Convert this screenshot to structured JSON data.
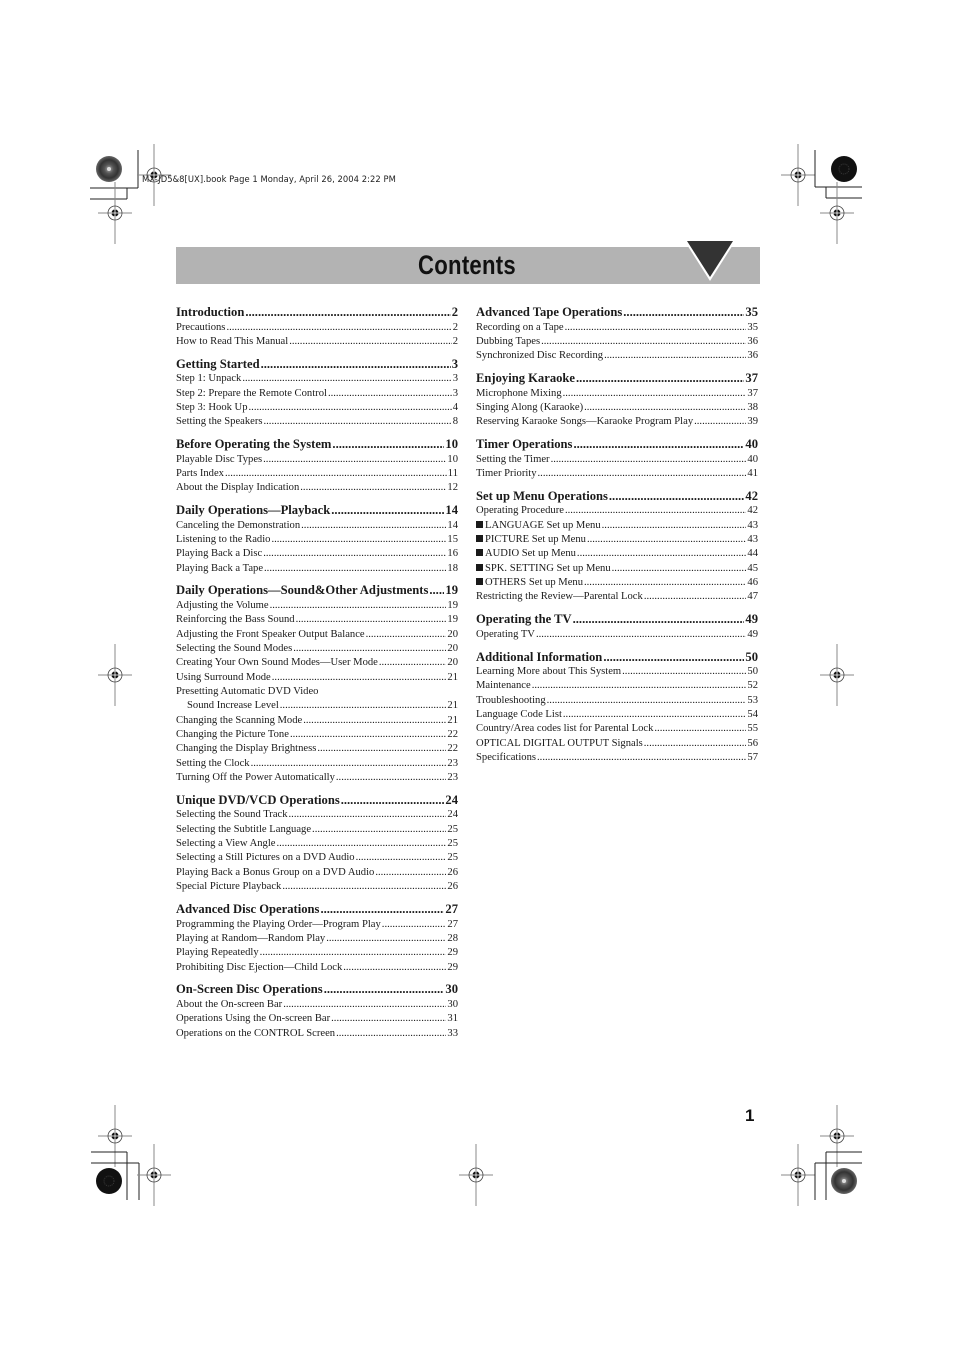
{
  "print_header": "MX-JD5&8[UX].book  Page 1  Monday, April 26, 2004  2:22 PM",
  "title": "Contents",
  "page_number": "1",
  "colors": {
    "title_bar": "#b3b3b3",
    "title_triangle": "#333333",
    "text": "#1a1a1a"
  },
  "left_column": [
    {
      "heading": "Introduction",
      "page": "2",
      "items": [
        {
          "label": "Precautions",
          "page": "2"
        },
        {
          "label": "How to Read This Manual",
          "page": "2"
        }
      ]
    },
    {
      "heading": "Getting Started",
      "page": "3",
      "items": [
        {
          "label": "Step 1: Unpack",
          "page": "3"
        },
        {
          "label": "Step 2: Prepare the Remote Control",
          "page": "3"
        },
        {
          "label": "Step 3: Hook Up",
          "page": "4"
        },
        {
          "label": "Setting the Speakers",
          "page": "8"
        }
      ]
    },
    {
      "heading": "Before Operating the System",
      "page": "10",
      "items": [
        {
          "label": "Playable Disc Types",
          "page": "10"
        },
        {
          "label": "Parts Index",
          "page": "11"
        },
        {
          "label": "About the Display Indication",
          "page": "12"
        }
      ]
    },
    {
      "heading": "Daily Operations—Playback",
      "page": "14",
      "items": [
        {
          "label": "Canceling the Demonstration",
          "page": "14"
        },
        {
          "label": "Listening to the Radio",
          "page": "15"
        },
        {
          "label": "Playing Back a Disc",
          "page": "16"
        },
        {
          "label": "Playing Back a Tape",
          "page": "18"
        }
      ]
    },
    {
      "heading": "Daily Operations—Sound&Other Adjustments",
      "page": "19",
      "items": [
        {
          "label": "Adjusting the Volume",
          "page": "19"
        },
        {
          "label": "Reinforcing the Bass Sound",
          "page": "19"
        },
        {
          "label": "Adjusting the Front Speaker Output Balance",
          "page": "20"
        },
        {
          "label": "Selecting the Sound Modes",
          "page": "20"
        },
        {
          "label": "Creating Your Own Sound Modes—User Mode",
          "page": "20"
        },
        {
          "label": "Using Surround Mode",
          "page": "21"
        },
        {
          "label": "Presetting Automatic DVD Video",
          "continuation": "Sound Increase Level",
          "page": "21"
        },
        {
          "label": "Changing the Scanning Mode",
          "page": "21"
        },
        {
          "label": "Changing the Picture Tone",
          "page": "22"
        },
        {
          "label": "Changing the Display Brightness",
          "page": "22"
        },
        {
          "label": "Setting the Clock",
          "page": "23"
        },
        {
          "label": "Turning Off the Power Automatically",
          "page": "23"
        }
      ]
    },
    {
      "heading": "Unique DVD/VCD Operations",
      "page": "24",
      "items": [
        {
          "label": "Selecting the Sound Track",
          "page": "24"
        },
        {
          "label": "Selecting the Subtitle Language",
          "page": "25"
        },
        {
          "label": "Selecting a View Angle",
          "page": "25"
        },
        {
          "label": "Selecting a Still Pictures on a DVD Audio",
          "page": "25"
        },
        {
          "label": "Playing Back a Bonus Group on a DVD Audio",
          "page": "26"
        },
        {
          "label": "Special Picture Playback",
          "page": "26"
        }
      ]
    },
    {
      "heading": "Advanced Disc Operations",
      "page": "27",
      "items": [
        {
          "label": "Programming the Playing Order—Program Play",
          "page": "27"
        },
        {
          "label": "Playing at Random—Random Play",
          "page": "28"
        },
        {
          "label": "Playing Repeatedly",
          "page": "29"
        },
        {
          "label": "Prohibiting Disc Ejection—Child Lock",
          "page": "29"
        }
      ]
    },
    {
      "heading": "On-Screen Disc Operations",
      "page": "30",
      "items": [
        {
          "label": "About the On-screen Bar",
          "page": "30"
        },
        {
          "label": "Operations Using the On-screen Bar",
          "page": "31"
        },
        {
          "label": "Operations on the CONTROL Screen",
          "page": "33"
        }
      ]
    }
  ],
  "right_column": [
    {
      "heading": "Advanced Tape Operations",
      "page": "35",
      "items": [
        {
          "label": "Recording on a Tape",
          "page": "35"
        },
        {
          "label": "Dubbing Tapes",
          "page": "36"
        },
        {
          "label": "Synchronized Disc Recording",
          "page": "36"
        }
      ]
    },
    {
      "heading": "Enjoying Karaoke",
      "page": "37",
      "items": [
        {
          "label": "Microphone Mixing",
          "page": "37"
        },
        {
          "label": "Singing Along (Karaoke)",
          "page": "38"
        },
        {
          "label": "Reserving Karaoke Songs—Karaoke Program Play",
          "page": "39"
        }
      ]
    },
    {
      "heading": "Timer Operations",
      "page": "40",
      "items": [
        {
          "label": "Setting the Timer",
          "page": "40"
        },
        {
          "label": "Timer Priority",
          "page": "41"
        }
      ]
    },
    {
      "heading": "Set up Menu Operations",
      "page": "42",
      "items": [
        {
          "label": "Operating Procedure",
          "page": "42"
        },
        {
          "label": "LANGUAGE Set up Menu",
          "page": "43",
          "bullet": true
        },
        {
          "label": "PICTURE Set up Menu",
          "page": "43",
          "bullet": true
        },
        {
          "label": "AUDIO Set up Menu",
          "page": "44",
          "bullet": true
        },
        {
          "label": "SPK. SETTING Set up Menu",
          "page": "45",
          "bullet": true
        },
        {
          "label": "OTHERS Set up Menu",
          "page": "46",
          "bullet": true
        },
        {
          "label": "Restricting the Review—Parental Lock",
          "page": "47"
        }
      ]
    },
    {
      "heading": "Operating the TV",
      "page": "49",
      "items": [
        {
          "label": "Operating TV",
          "page": "49"
        }
      ]
    },
    {
      "heading": "Additional Information",
      "page": "50",
      "items": [
        {
          "label": "Learning More about This System",
          "page": "50"
        },
        {
          "label": "Maintenance",
          "page": "52"
        },
        {
          "label": "Troubleshooting",
          "page": "53"
        },
        {
          "label": "Language Code List",
          "page": "54"
        },
        {
          "label": "Country/Area codes list for Parental Lock",
          "page": "55"
        },
        {
          "label": "OPTICAL DIGITAL OUTPUT Signals",
          "page": "56"
        },
        {
          "label": "Specifications",
          "page": "57"
        }
      ]
    }
  ],
  "icons": {
    "registration_mark": "crosshair-circle",
    "corner_target": "radial-starburst-disc",
    "title_decoration": "down-triangle"
  }
}
